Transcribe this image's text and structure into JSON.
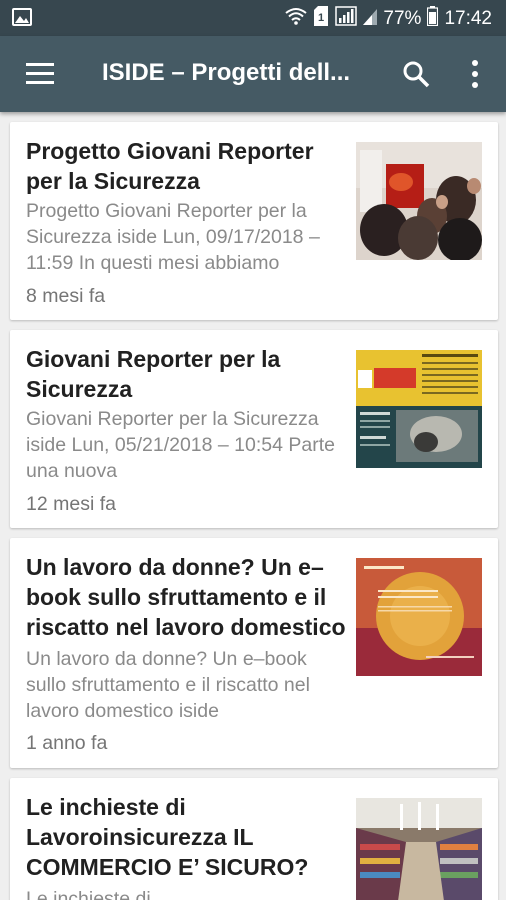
{
  "status_bar": {
    "battery_percent": "77%",
    "time": "17:42",
    "icons": [
      "image-icon",
      "wifi-icon",
      "sim-icon",
      "signal-icon",
      "battery-icon"
    ]
  },
  "app_bar": {
    "title": "ISIDE – Progetti dell...",
    "icons": [
      "menu-icon",
      "search-icon",
      "more-vert-icon"
    ]
  },
  "articles": [
    {
      "title": "Progetto Giovani Reporter per la Sicurezza",
      "snippet": "Progetto Giovani Reporter per la Sicurezza iside Lun, 09/17/2018 – 11:59 In questi mesi abbiamo",
      "age": "8 mesi fa"
    },
    {
      "title": "Giovani Reporter per la Sicurezza",
      "snippet": "Giovani Reporter per la Sicurezza iside Lun, 05/21/2018 – 10:54 Parte una nuova",
      "age": "12 mesi fa"
    },
    {
      "title": "Un lavoro da donne? Un e–book sullo sfruttamento e il riscatto nel lavoro domestico",
      "snippet": "Un lavoro da donne? Un e–book sullo sfruttamento e il riscatto nel lavoro domestico iside",
      "age": "1 anno fa"
    },
    {
      "title": "Le inchieste di Lavoroinsicurezza IL COMMERCIO E’ SICURO?",
      "snippet": "Le inchieste di",
      "age": ""
    }
  ],
  "colors": {
    "status_bar": "#37474f",
    "app_bar": "#455a64",
    "background": "#efefef",
    "card": "#ffffff"
  }
}
